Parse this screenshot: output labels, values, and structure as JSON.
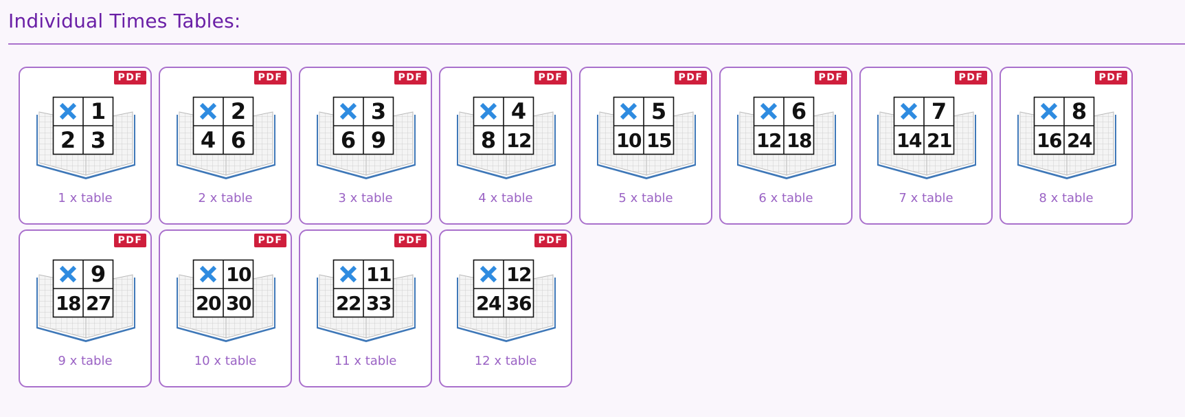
{
  "section": {
    "heading": "Individual Times Tables:"
  },
  "colors": {
    "heading": "#6a1fa6",
    "card_border": "#a970cc",
    "label": "#9a62c4",
    "pdf_badge": "#cf1e3c",
    "times_sign": "#2e8be0",
    "book_cover": "#3f78b8"
  },
  "icons": {
    "badge": "pdf-icon",
    "thumbnail": "times-table-book-icon",
    "operator": "multiply-icon"
  },
  "tables": [
    {
      "n": "1",
      "a": "2",
      "b": "3",
      "label": "1 x table",
      "badge": "PDF"
    },
    {
      "n": "2",
      "a": "4",
      "b": "6",
      "label": "2 x table",
      "badge": "PDF"
    },
    {
      "n": "3",
      "a": "6",
      "b": "9",
      "label": "3 x table",
      "badge": "PDF"
    },
    {
      "n": "4",
      "a": "8",
      "b": "12",
      "label": "4 x table",
      "badge": "PDF"
    },
    {
      "n": "5",
      "a": "10",
      "b": "15",
      "label": "5 x table",
      "badge": "PDF"
    },
    {
      "n": "6",
      "a": "12",
      "b": "18",
      "label": "6 x table",
      "badge": "PDF"
    },
    {
      "n": "7",
      "a": "14",
      "b": "21",
      "label": "7 x table",
      "badge": "PDF"
    },
    {
      "n": "8",
      "a": "16",
      "b": "24",
      "label": "8 x table",
      "badge": "PDF"
    },
    {
      "n": "9",
      "a": "18",
      "b": "27",
      "label": "9 x table",
      "badge": "PDF"
    },
    {
      "n": "10",
      "a": "20",
      "b": "30",
      "label": "10 x table",
      "badge": "PDF"
    },
    {
      "n": "11",
      "a": "22",
      "b": "33",
      "label": "11 x table",
      "badge": "PDF"
    },
    {
      "n": "12",
      "a": "24",
      "b": "36",
      "label": "12 x table",
      "badge": "PDF"
    }
  ]
}
